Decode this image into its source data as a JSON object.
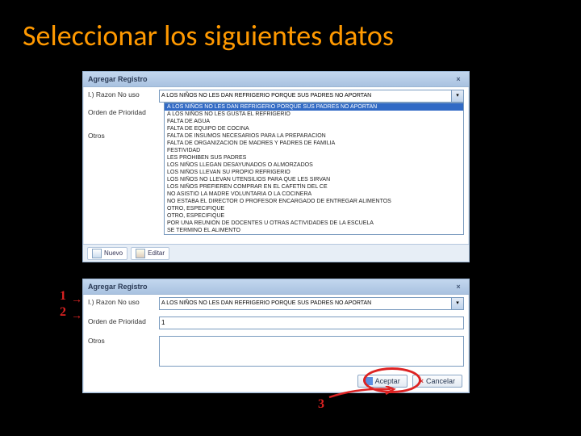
{
  "title": "Seleccionar los siguientes datos",
  "panel1": {
    "header": "Agregar Registro",
    "label_razon": "I.) Razon No uso",
    "label_prioridad": "Orden de Prioridad",
    "label_otros": "Otros",
    "sel_value": "A LOS NIÑOS NO LES DAN REFRIGERIO PORQUE SUS PADRES NO APORTAN",
    "options": [
      "A LOS NIÑOS NO LES DAN REFRIGERIO PORQUE SUS PADRES NO APORTAN",
      "A LOS NIÑOS NO LES GUSTA EL REFRIGERIO",
      "FALTA DE AGUA",
      "FALTA DE EQUIPO DE COCINA",
      "FALTA DE INSUMOS NECESARIOS PARA LA PREPARACION",
      "FALTA DE ORGANIZACION DE MADRES Y PADRES DE FAMILIA",
      "FESTIVIDAD",
      "LES PROHIBEN SUS PADRES",
      "LOS NIÑOS LLEGAN DESAYUNADOS O ALMORZADOS",
      "LOS NIÑOS LLEVAN SU PROPIO REFRIGERIO",
      "LOS NIÑOS NO LLEVAN UTENSILIOS PARA QUE LES SIRVAN",
      "LOS NIÑOS PREFIEREN COMPRAR EN EL CAFETÍN DEL CE",
      "NO ASISTIÓ LA MADRE VOLUNTARIA O LA COCINERA",
      "NO ESTABA EL DIRECTOR O PROFESOR ENCARGADO DE ENTREGAR ALIMENTOS",
      "OTRO, ESPECIFIQUE",
      "OTRO, ESPECIFIQUE",
      "POR UNA REUNIÓN DE DOCENTES U OTRAS ACTIVIDADES DE LA ESCUELA",
      "SE TERMINO EL ALIMENTO"
    ],
    "toolbar": {
      "nuevo": "Nuevo",
      "editar": "Editar"
    }
  },
  "panel2": {
    "header": "Agregar Registro",
    "label_razon": "I.) Razon No uso",
    "label_prioridad": "Orden de Prioridad",
    "label_otros": "Otros",
    "sel_value": "A LOS NIÑOS NO LES DAN REFRIGERIO PORQUE SUS PADRES NO APORTAN",
    "prioridad_value": "1",
    "btn_aceptar": "Aceptar",
    "btn_cancelar": "Cancelar"
  },
  "annotations": {
    "a1": "1",
    "a2": "2",
    "a3": "3",
    "arrow": "→"
  }
}
